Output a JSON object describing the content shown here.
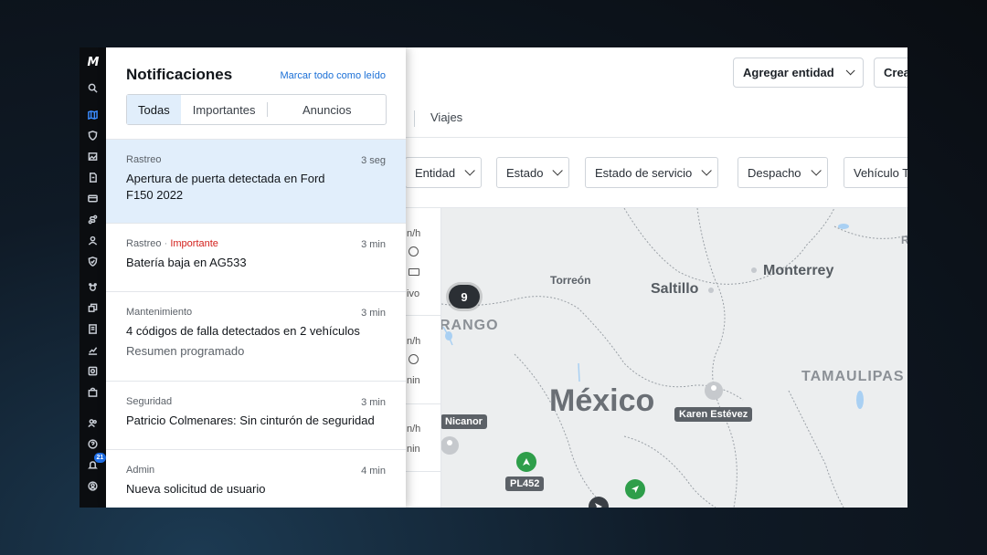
{
  "rail": {
    "logo": "M",
    "badge_count": "21"
  },
  "header": {
    "add_entity": "Agregar entidad",
    "create": "Crea"
  },
  "tabs": {
    "trips": "Viajes"
  },
  "filters": [
    {
      "label": "Entidad"
    },
    {
      "label": "Estado"
    },
    {
      "label": "Estado de servicio"
    },
    {
      "label": "Despacho"
    },
    {
      "label": "Vehículo T"
    }
  ],
  "list_fragments": [
    "n/h",
    "ivo",
    "n/h",
    "nin",
    "n/h",
    "nin"
  ],
  "map": {
    "cluster": "9",
    "cities": {
      "torreon": "Torreón",
      "saltillo": "Saltillo",
      "monterrey": "Monterrey"
    },
    "regions": {
      "durango": "RANGO",
      "tamaulipas": "TAMAULIPAS",
      "right_edge": "R"
    },
    "country": "México",
    "tags": {
      "nicanor": "Nicanor",
      "karen": "Karen Estévez",
      "pl452": "PL452"
    }
  },
  "notifications": {
    "title": "Notificaciones",
    "mark_all": "Marcar todo como leído",
    "segments": [
      "Todas",
      "Importantes",
      "Anuncios"
    ],
    "items": [
      {
        "category": "Rastreo",
        "important": "",
        "time": "3 seg",
        "message": "Apertura de puerta detectada en Ford F150 2022",
        "sub": ""
      },
      {
        "category": "Rastreo",
        "important": "Importante",
        "time": "3 min",
        "message": "Batería baja en AG533",
        "sub": ""
      },
      {
        "category": "Mantenimiento",
        "important": "",
        "time": "3 min",
        "message": "4 códigos de falla detectados en 2 vehículos",
        "sub": "Resumen programado"
      },
      {
        "category": "Seguridad",
        "important": "",
        "time": "3 min",
        "message": "Patricio Colmenares: Sin cinturón de seguridad",
        "sub": ""
      },
      {
        "category": "Admin",
        "important": "",
        "time": "4 min",
        "message": "Nueva solicitud de usuario",
        "sub": ""
      }
    ]
  }
}
